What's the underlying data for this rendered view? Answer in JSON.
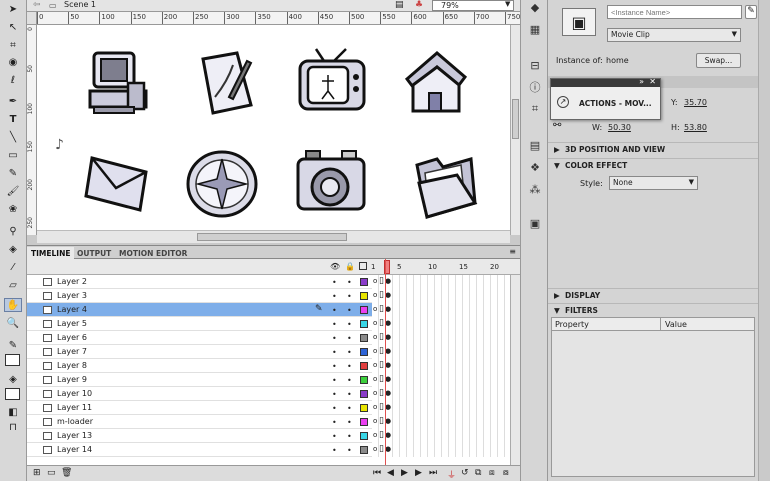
{
  "scene_label": "Scene 1",
  "zoom": "79%",
  "ruler": {
    "top_ticks": [
      "0",
      "50",
      "100",
      "150",
      "200",
      "250",
      "300",
      "350",
      "400",
      "450",
      "500",
      "550",
      "600",
      "650",
      "700",
      "750"
    ],
    "left_ticks": [
      "0",
      "50",
      "100",
      "150",
      "200",
      "250"
    ]
  },
  "panel_tabs": [
    "TIMELINE",
    "OUTPUT",
    "MOTION EDITOR"
  ],
  "frame_numbers": [
    "1",
    "5",
    "10",
    "15",
    "20"
  ],
  "layers": [
    {
      "name": "Layer 2",
      "color": "#8a3cc9"
    },
    {
      "name": "Layer 3",
      "color": "#e8e400"
    },
    {
      "name": "Layer 4",
      "color": "#ea3ff0",
      "selected": true
    },
    {
      "name": "Layer 5",
      "color": "#39d6e6"
    },
    {
      "name": "Layer 6",
      "color": "#8b8b8b"
    },
    {
      "name": "Layer 7",
      "color": "#2d63d6"
    },
    {
      "name": "Layer 8",
      "color": "#e24040"
    },
    {
      "name": "Layer 9",
      "color": "#3ccf3c"
    },
    {
      "name": "Layer 10",
      "color": "#8a3cc9"
    },
    {
      "name": "Layer 11",
      "color": "#e8e400"
    },
    {
      "name": "m-loader",
      "color": "#ea3ff0"
    },
    {
      "name": "Layer 13",
      "color": "#39d6e6"
    },
    {
      "name": "Layer 14",
      "color": "#8b8b8b"
    }
  ],
  "props": {
    "instance_name_placeholder": "<Instance Name>",
    "symbol_type": "Movie Clip",
    "instance_of_label": "Instance of:",
    "instance_of_value": "home",
    "swap_label": "Swap...",
    "y_label": "Y:",
    "y_value": "35.70",
    "w_label": "W:",
    "w_value": "50.30",
    "h_label": "H:",
    "h_value": "53.80",
    "sect_3d": "3D POSITION AND VIEW",
    "sect_color": "COLOR EFFECT",
    "style_label": "Style:",
    "style_value": "None",
    "sect_display": "DISPLAY",
    "sect_filters": "FILTERS",
    "filters_col_property": "Property",
    "filters_col_value": "Value"
  },
  "actions_popup": {
    "title": "ACTIONS - MOV..."
  },
  "stage_icons": [
    "computer",
    "notepad",
    "tv",
    "house",
    "envelope",
    "compass",
    "camera",
    "folder"
  ],
  "colors": {
    "selection": "#7eaee9",
    "link": "#1a5fb4",
    "playhead": "#e05050"
  }
}
